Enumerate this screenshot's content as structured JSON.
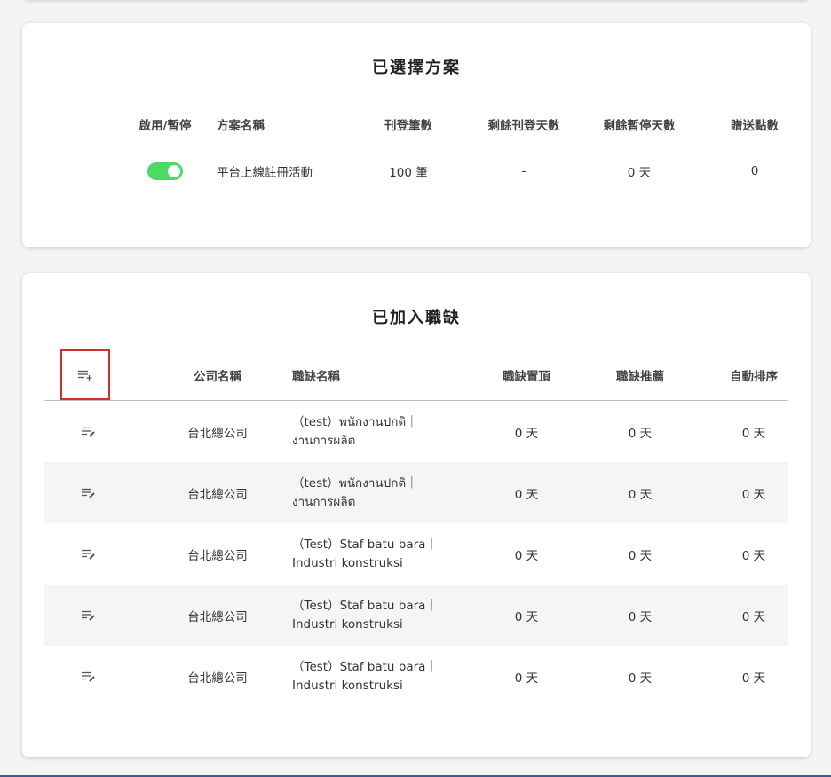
{
  "plan_card": {
    "title": "已選擇方案",
    "headers": {
      "toggle": "啟用/暫停",
      "plan_name": "方案名稱",
      "posts": "刊登筆數",
      "remaining_days": "剩餘刊登天數",
      "remaining_pause": "剩餘暫停天數",
      "bonus_points": "贈送點數"
    },
    "row": {
      "enabled": true,
      "plan_name": "平台上線註冊活動",
      "posts": "100 筆",
      "remaining_days": "-",
      "remaining_pause": "0 天",
      "bonus_points": "0"
    }
  },
  "jobs_card": {
    "title": "已加入職缺",
    "headers": {
      "company": "公司名稱",
      "job": "職缺名稱",
      "pin": "職缺置頂",
      "recommend": "職缺推薦",
      "auto_sort": "自動排序"
    },
    "rows": [
      {
        "company": "台北總公司",
        "job_line1": "（test）พนักงานปกติ｜",
        "job_line2": "งานการผลิต",
        "pin": "0 天",
        "recommend": "0 天",
        "auto_sort": "0 天"
      },
      {
        "company": "台北總公司",
        "job_line1": "（test）พนักงานปกติ｜",
        "job_line2": "งานการผลิต",
        "pin": "0 天",
        "recommend": "0 天",
        "auto_sort": "0 天"
      },
      {
        "company": "台北總公司",
        "job_line1": "（Test）Staf batu bara｜",
        "job_line2": "Industri konstruksi",
        "pin": "0 天",
        "recommend": "0 天",
        "auto_sort": "0 天"
      },
      {
        "company": "台北總公司",
        "job_line1": "（Test）Staf batu bara｜",
        "job_line2": "Industri konstruksi",
        "pin": "0 天",
        "recommend": "0 天",
        "auto_sort": "0 天"
      },
      {
        "company": "台北總公司",
        "job_line1": "（Test）Staf batu bara｜",
        "job_line2": "Industri konstruksi",
        "pin": "0 天",
        "recommend": "0 天",
        "auto_sort": "0 天"
      }
    ]
  },
  "colors": {
    "toggle_on": "#4cd964",
    "highlight_box": "#d0302a",
    "row_alt": "#f5f5f5"
  },
  "icons": {
    "add_list": "playlist-add-icon",
    "edit_list": "playlist-edit-icon"
  }
}
